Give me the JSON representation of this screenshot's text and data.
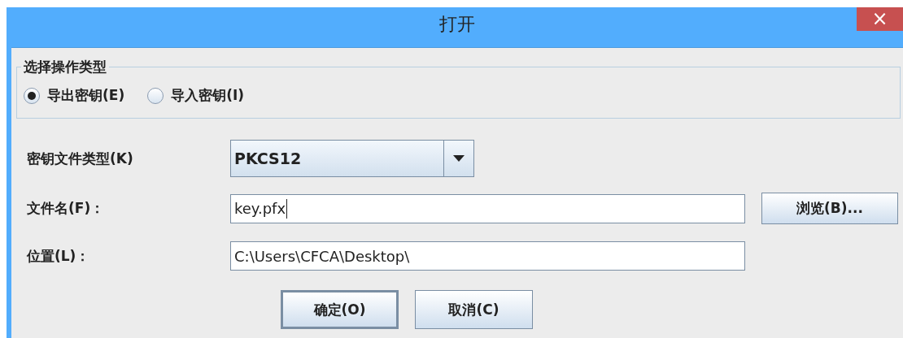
{
  "window": {
    "title": "打开",
    "close": "×"
  },
  "operation_group": {
    "legend": "选择操作类型",
    "options": [
      {
        "label": "导出密钥(E)",
        "selected": true
      },
      {
        "label": "导入密钥(I)",
        "selected": false
      }
    ]
  },
  "key_type": {
    "label": "密钥文件类型(K)",
    "value": "PKCS12"
  },
  "file_name": {
    "label": "文件名(F)：",
    "value": "key.pfx",
    "browse": "浏览(B)..."
  },
  "location": {
    "label": "位置(L)：",
    "value": "C:\\Users\\CFCA\\Desktop\\"
  },
  "buttons": [
    {
      "label": "确定(O)",
      "focused": true
    },
    {
      "label": "取消(C)",
      "focused": false
    }
  ]
}
